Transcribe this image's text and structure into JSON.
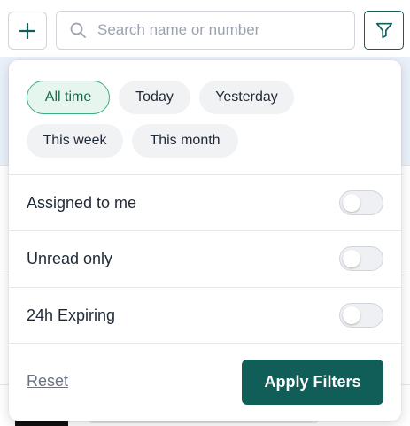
{
  "search": {
    "placeholder": "Search name or number",
    "value": ""
  },
  "icons": {
    "add": "plus-icon",
    "search": "search-icon",
    "filter": "filter-icon"
  },
  "filters": {
    "date_chips": [
      {
        "label": "All time",
        "selected": true
      },
      {
        "label": "Today",
        "selected": false
      },
      {
        "label": "Yesterday",
        "selected": false
      },
      {
        "label": "This week",
        "selected": false
      },
      {
        "label": "This month",
        "selected": false
      }
    ],
    "toggles": [
      {
        "label": "Assigned to me",
        "on": false
      },
      {
        "label": "Unread only",
        "on": false
      },
      {
        "label": "24h Expiring",
        "on": false
      }
    ],
    "reset_label": "Reset",
    "apply_label": "Apply Filters"
  },
  "colors": {
    "brand": "#115e59",
    "chip_active_bg": "#e6f6ee",
    "chip_active_border": "#3fae82"
  }
}
